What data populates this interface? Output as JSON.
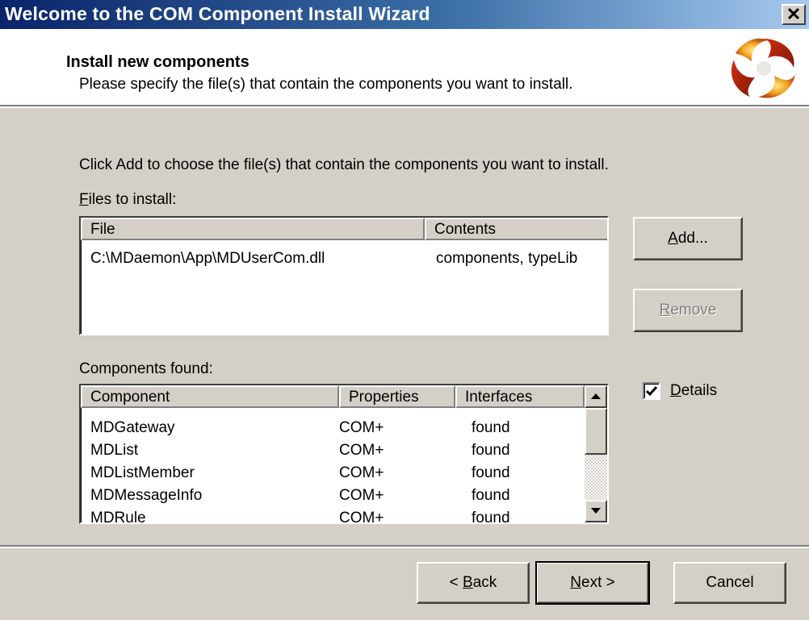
{
  "window": {
    "title": "Welcome to the COM Component Install Wizard",
    "close_symbol": "✕"
  },
  "header": {
    "title": "Install new components",
    "subtitle": "Please specify the file(s) that contain the components you want to install.",
    "logo_icon": "component-services-swirl-icon"
  },
  "body": {
    "instruction": "Click Add to choose the file(s) that contain the components you want to install.",
    "files_label_prefix": "F",
    "files_label_rest": "iles to install:",
    "components_label": "Components found:"
  },
  "files_list": {
    "columns": [
      "File",
      "Contents"
    ],
    "rows": [
      [
        "C:\\MDaemon\\App\\MDUserCom.dll",
        "components, typeLib"
      ]
    ]
  },
  "components_list": {
    "columns": [
      "Component",
      "Properties",
      "Interfaces"
    ],
    "rows": [
      [
        "MDGateway",
        "COM+",
        "found"
      ],
      [
        "MDList",
        "COM+",
        "found"
      ],
      [
        "MDListMember",
        "COM+",
        "found"
      ],
      [
        "MDMessageInfo",
        "COM+",
        "found"
      ],
      [
        "MDRule",
        "COM+",
        "found"
      ]
    ]
  },
  "buttons": {
    "add_prefix": "A",
    "add_rest": "dd...",
    "remove_prefix": "R",
    "remove_rest": "emove",
    "back_pre": "< ",
    "back_key": "B",
    "back_rest": "ack",
    "next_key": "N",
    "next_rest": "ext >",
    "cancel": "Cancel"
  },
  "details": {
    "checked": true,
    "label_prefix": "D",
    "label_rest": "etails"
  },
  "colors": {
    "titlebar_start": "#0a246a",
    "titlebar_end": "#a6caf0",
    "face": "#d4d0c8"
  }
}
